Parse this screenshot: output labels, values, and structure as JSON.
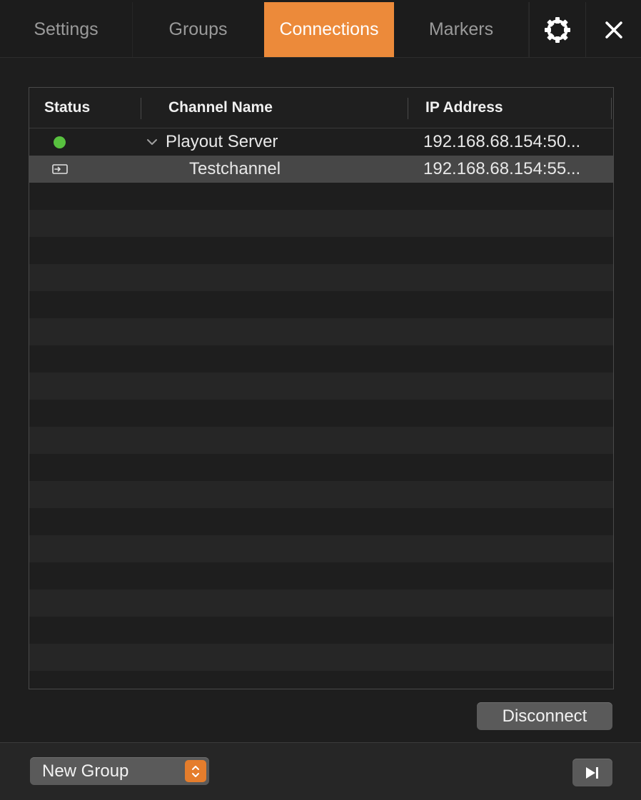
{
  "tabs": [
    {
      "label": "Settings"
    },
    {
      "label": "Groups"
    },
    {
      "label": "Connections"
    },
    {
      "label": "Markers"
    }
  ],
  "toolbar_icons": [
    "gear-icon",
    "close-icon"
  ],
  "accent_color": "#ec8a3a",
  "table": {
    "columns": [
      "Status",
      "Channel Name",
      "IP Address"
    ],
    "rows": [
      {
        "status": "connected",
        "status_color": "#58c13f",
        "name": "Playout Server",
        "ip": "192.168.68.154:50...",
        "expanded": true
      },
      {
        "status_icon": "channel-input-icon",
        "name": "Testchannel",
        "ip": "192.168.68.154:55...",
        "selected": true
      }
    ]
  },
  "disconnect_label": "Disconnect",
  "footer": {
    "group_select_value": "New Group",
    "play_icon": "skip-forward-icon"
  }
}
